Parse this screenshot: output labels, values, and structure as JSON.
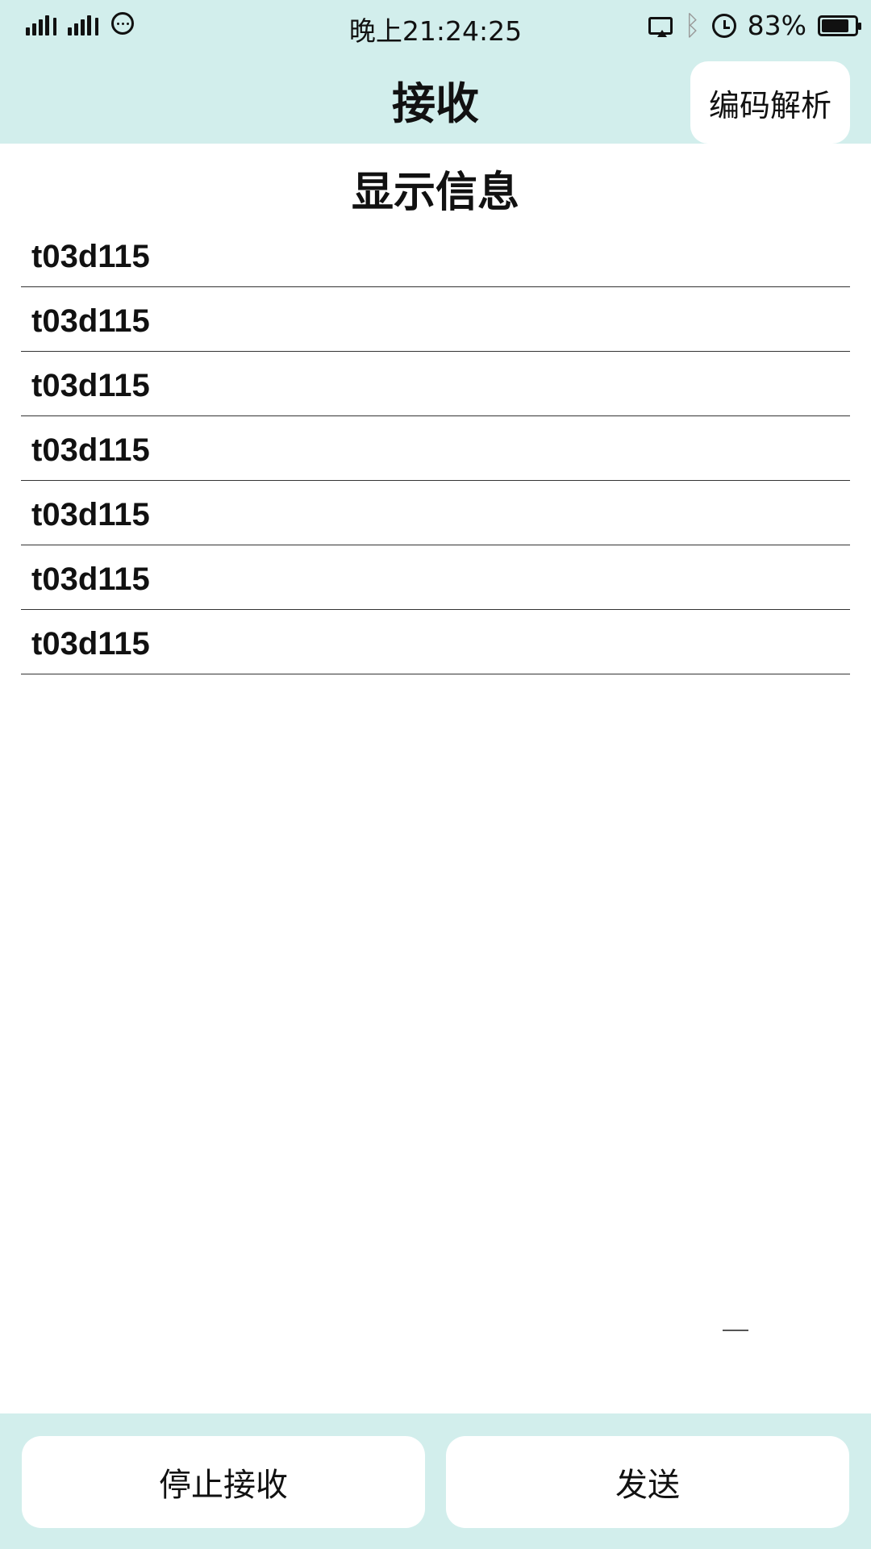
{
  "status_bar": {
    "time": "晚上21:24:25",
    "battery_percent": "83%",
    "battery_level": 0.83,
    "icons": [
      "signal-icon",
      "signal-icon",
      "message-icon",
      "screen-cast-icon",
      "bluetooth-icon",
      "alarm-icon",
      "battery-icon"
    ]
  },
  "app_bar": {
    "title": "接收",
    "decode_button": "编码解析"
  },
  "content": {
    "section_title": "显示信息",
    "messages": [
      "t03d115",
      "t03d115",
      "t03d115",
      "t03d115",
      "t03d115",
      "t03d115",
      "t03d115"
    ]
  },
  "bottom_bar": {
    "stop_button": "停止接收",
    "send_button": "发送"
  },
  "colors": {
    "bar_background": "#d2eeec",
    "button_background": "#ffffff"
  }
}
